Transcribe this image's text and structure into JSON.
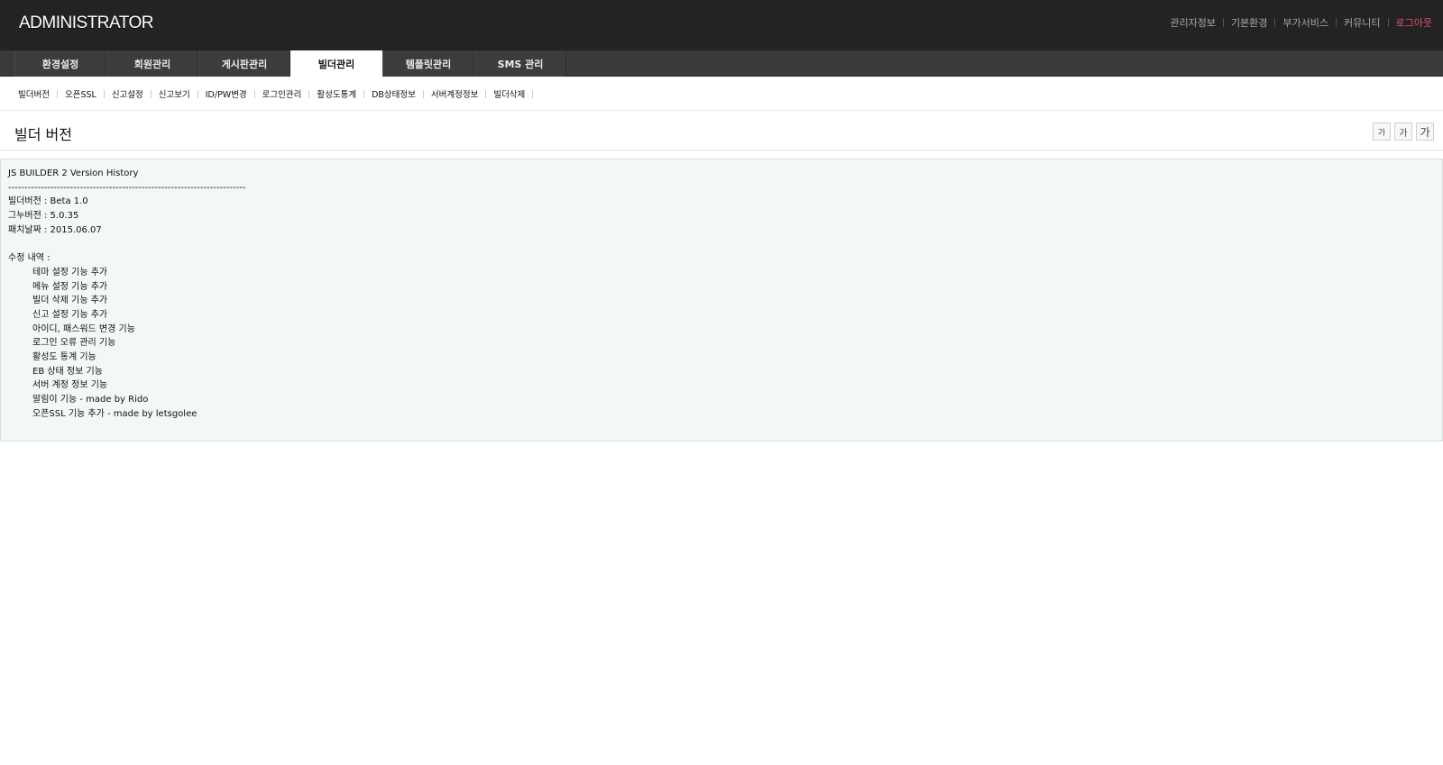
{
  "header": {
    "logo": "ADMINISTRATOR",
    "links": [
      "관리자정보",
      "기본환경",
      "부가서비스",
      "커뮤니티"
    ],
    "logout": "로그아웃"
  },
  "main_nav": {
    "tabs": [
      {
        "label": "환경설정"
      },
      {
        "label": "회원관리"
      },
      {
        "label": "게시판관리"
      },
      {
        "label": "빌더관리"
      },
      {
        "label": "템플릿관리"
      },
      {
        "label": "SMS 관리"
      }
    ],
    "active_tab": "빌더관리"
  },
  "sub_nav": {
    "items": [
      "빌더버전",
      "오픈SSL",
      "신고설정",
      "신고보기",
      "ID/PW변경",
      "로그인관리",
      "활성도통계",
      "DB상태정보",
      "서버계정정보",
      "빌더삭제"
    ]
  },
  "page": {
    "title": "빌더 버전",
    "font_buttons": [
      "가",
      "가",
      "가"
    ]
  },
  "content": {
    "heading": "JS BUILDER 2 Version History",
    "divider": "-------------------------------------------------------------------------",
    "builder_version": "빌더버전 : Beta 1.0",
    "gnu_version": "그누버전 : 5.0.35",
    "patch_date": "패치날짜 : 2015.06.07",
    "changes_label": "수정 내역 :",
    "changes": [
      "테마 설정 기능 추가",
      "메뉴 설정 기능 추가",
      "빌더 삭제 기능 추가",
      "신고 설정 기능 추가",
      "아이디, 패스워드 변경 기능",
      "로그인 오류 관리 기능",
      "활성도 통계 기능",
      "EB 상태 정보 기능",
      "서버 계정 정보 기능",
      "알림이 기능 - made by Rido",
      "오픈SSL 기능 추가 - made by letsgolee"
    ]
  },
  "colors": {
    "header_bg": "#232323",
    "nav_bg": "#3a3a3a",
    "logout": "#e0526b",
    "content_bg": "#f3f7f7"
  }
}
